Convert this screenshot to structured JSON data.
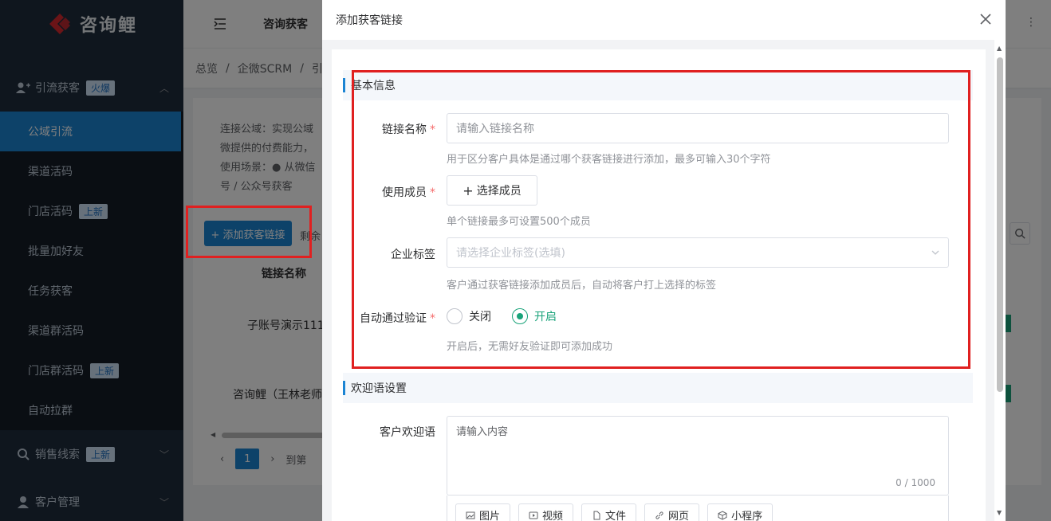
{
  "sidebar": {
    "logo_text": "咨询鲤",
    "groups": [
      {
        "label": "引流获客",
        "badge": "火爆"
      },
      {
        "label": "销售线索",
        "badge": "上新"
      },
      {
        "label": "客户管理",
        "badge": ""
      }
    ],
    "items": [
      {
        "label": "公域引流",
        "badge": ""
      },
      {
        "label": "渠道活码",
        "badge": ""
      },
      {
        "label": "门店活码",
        "badge": "上新"
      },
      {
        "label": "批量加好友",
        "badge": ""
      },
      {
        "label": "任务获客",
        "badge": ""
      },
      {
        "label": "渠道群活码",
        "badge": ""
      },
      {
        "label": "门店群活码",
        "badge": "上新"
      },
      {
        "label": "自动拉群",
        "badge": ""
      }
    ]
  },
  "topbar": {
    "title": "咨询获客"
  },
  "breadcrumb": [
    "总览",
    "/",
    "企微SCRM",
    "/",
    "引"
  ],
  "background_page": {
    "intro_lines": [
      "连接公域：实现公域",
      "微提供的付费能力，",
      "使用场景：● 从微信",
      "号 / 公众号获客"
    ],
    "add_button": "+ 添加获客链接",
    "remain": "剩余",
    "column_name": "链接名称",
    "rows": [
      "子账号演示111",
      "咨询鲤（王林老师"
    ],
    "page": "1",
    "goto": "到第"
  },
  "drawer": {
    "title": "添加获客链接",
    "sections": {
      "basic": "基本信息",
      "welcome": "欢迎语设置"
    },
    "fields": {
      "link_name": {
        "label": "链接名称",
        "placeholder": "请输入链接名称",
        "help": "用于区分客户具体是通过哪个获客链接进行添加，最多可输入30个字符"
      },
      "members": {
        "label": "使用成员",
        "button": "选择成员",
        "help": "单个链接最多可设置500个成员"
      },
      "tags": {
        "label": "企业标签",
        "placeholder": "请选择企业标签(选填)",
        "help": "客户通过获客链接添加成员后，自动将客户打上选择的标签"
      },
      "auto_verify": {
        "label": "自动通过验证",
        "options": [
          "关闭",
          "开启"
        ],
        "selected": "开启",
        "help": "开启后，无需好友验证即可添加成功"
      },
      "welcome_msg": {
        "label": "客户欢迎语",
        "placeholder": "请输入内容",
        "counter": "0 / 1000"
      }
    },
    "attachments": [
      "图片",
      "视频",
      "文件",
      "网页",
      "小程序"
    ]
  },
  "colors": {
    "accent": "#1b84d3",
    "success": "#1aa37a",
    "highlight": "#e02020"
  }
}
